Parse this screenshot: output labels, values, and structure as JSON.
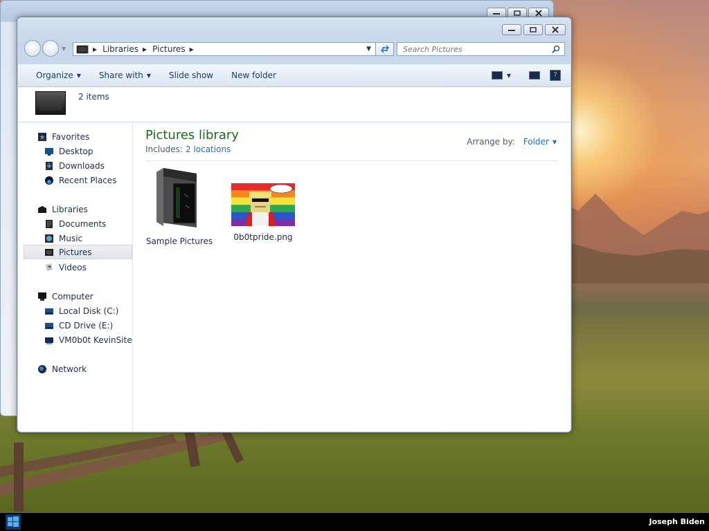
{
  "explorer": {
    "address": {
      "crumbs": [
        "Libraries",
        "Pictures"
      ]
    },
    "search": {
      "placeholder": "Search Pictures"
    },
    "toolbar": {
      "organize_label": "Organize",
      "share_label": "Share with",
      "slideshow_label": "Slide show",
      "newfolder_label": "New folder"
    },
    "item_count": "2 items",
    "nav": {
      "favorites": {
        "label": "Favorites",
        "items": [
          "Desktop",
          "Downloads",
          "Recent Places"
        ]
      },
      "libraries": {
        "label": "Libraries",
        "items": [
          "Documents",
          "Music",
          "Pictures",
          "Videos"
        ],
        "selected": "Pictures"
      },
      "computer": {
        "label": "Computer",
        "items": [
          "Local Disk (C:)",
          "CD Drive (E:)",
          "VM0b0t KevinSite"
        ]
      },
      "network": {
        "label": "Network"
      }
    },
    "content": {
      "title": "Pictures library",
      "includes_label": "Includes:",
      "includes_link": "2 locations",
      "arrange_label": "Arrange by:",
      "arrange_value": "Folder",
      "files": [
        {
          "name": "Sample Pictures",
          "icon": "folder-icon"
        },
        {
          "name": "0b0tpride.png",
          "icon": "image-thumbnail"
        }
      ]
    }
  },
  "taskbar": {
    "user_name": "Joseph Biden",
    "start_icon": "windows-logo-icon"
  },
  "colors": {
    "library_title": "#1c6a1c",
    "link": "#1f6fb6",
    "taskbar": "#000000"
  }
}
